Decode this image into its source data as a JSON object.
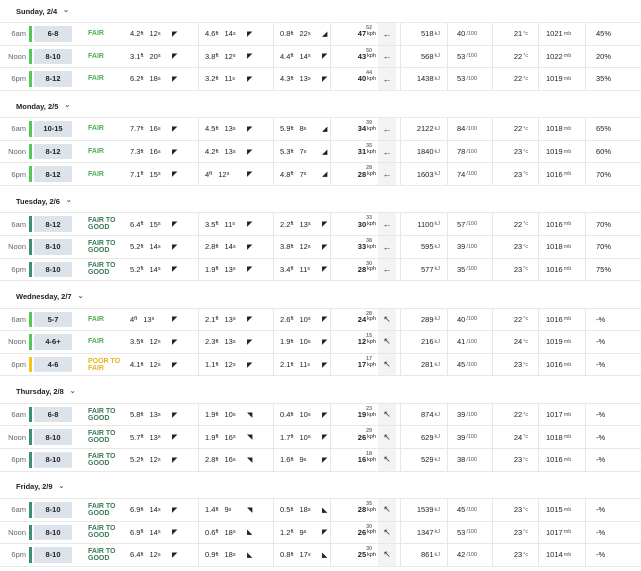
{
  "days": [
    {
      "title": "Sunday, 2/4",
      "rows": [
        {
          "time": "6am",
          "size": "6-8",
          "rating": "FAIR",
          "rc": "fair",
          "s1h": "4.2",
          "s1p": "12",
          "s1a": "◤",
          "s2h": "4.6",
          "s2p": "14",
          "s2a": "◤",
          "s3h": "0.8",
          "s3p": "22",
          "s3a": "◢",
          "wind": "47",
          "gust": "52",
          "warrow": "←",
          "energy": "518",
          "cons": "40",
          "temp": "21",
          "pres": "1021",
          "cloud": "45%"
        },
        {
          "time": "Noon",
          "size": "8-10",
          "rating": "FAIR",
          "rc": "fair",
          "s1h": "3.1",
          "s1p": "20",
          "s1a": "◤",
          "s2h": "3.8",
          "s2p": "12",
          "s2a": "◤",
          "s3h": "4.4",
          "s3p": "14",
          "s3a": "◤",
          "wind": "43",
          "gust": "50",
          "warrow": "←",
          "energy": "568",
          "cons": "53",
          "temp": "22",
          "pres": "1022",
          "cloud": "20%"
        },
        {
          "time": "6pm",
          "size": "8-12",
          "rating": "FAIR",
          "rc": "fair",
          "s1h": "6.2",
          "s1p": "18",
          "s1a": "◤",
          "s2h": "3.2",
          "s2p": "11",
          "s2a": "◤",
          "s3h": "4.3",
          "s3p": "13",
          "s3a": "◤",
          "wind": "40",
          "gust": "44",
          "warrow": "←",
          "energy": "1438",
          "cons": "53",
          "temp": "22",
          "pres": "1019",
          "cloud": "35%"
        }
      ]
    },
    {
      "title": "Monday, 2/5",
      "rows": [
        {
          "time": "6am",
          "size": "10-15",
          "rating": "FAIR",
          "rc": "fair",
          "s1h": "7.7",
          "s1p": "16",
          "s1a": "◤",
          "s2h": "4.5",
          "s2p": "13",
          "s2a": "◤",
          "s3h": "5.9",
          "s3p": "8",
          "s3a": "◢",
          "wind": "34",
          "gust": "39",
          "warrow": "←",
          "energy": "2122",
          "cons": "84",
          "temp": "22",
          "pres": "1018",
          "cloud": "65%"
        },
        {
          "time": "Noon",
          "size": "8-12",
          "rating": "FAIR",
          "rc": "fair",
          "s1h": "7.3",
          "s1p": "16",
          "s1a": "◤",
          "s2h": "4.2",
          "s2p": "13",
          "s2a": "◤",
          "s3h": "5.3",
          "s3p": "7",
          "s3a": "◢",
          "wind": "31",
          "gust": "35",
          "warrow": "←",
          "energy": "1840",
          "cons": "78",
          "temp": "23",
          "pres": "1019",
          "cloud": "60%"
        },
        {
          "time": "6pm",
          "size": "8-12",
          "rating": "FAIR",
          "rc": "fair",
          "s1h": "7.1",
          "s1p": "15",
          "s1a": "◤",
          "s2h": "4",
          "s2p": "12",
          "s2a": "◤",
          "s3h": "4.8",
          "s3p": "7",
          "s3a": "◢",
          "wind": "28",
          "gust": "28",
          "warrow": "←",
          "energy": "1603",
          "cons": "74",
          "temp": "23",
          "pres": "1016",
          "cloud": "70%"
        }
      ]
    },
    {
      "title": "Tuesday, 2/6",
      "rows": [
        {
          "time": "6am",
          "size": "8-12",
          "rating": "FAIR TO GOOD",
          "rc": "good",
          "s1h": "6.4",
          "s1p": "15",
          "s1a": "◤",
          "s2h": "3.5",
          "s2p": "11",
          "s2a": "◤",
          "s3h": "2.2",
          "s3p": "13",
          "s3a": "◤",
          "wind": "30",
          "gust": "33",
          "warrow": "←",
          "energy": "1100",
          "cons": "57",
          "temp": "22",
          "pres": "1016",
          "cloud": "70%"
        },
        {
          "time": "Noon",
          "size": "8-10",
          "rating": "FAIR TO GOOD",
          "rc": "good",
          "s1h": "5.2",
          "s1p": "14",
          "s1a": "◤",
          "s2h": "2.8",
          "s2p": "14",
          "s2a": "◤",
          "s3h": "3.8",
          "s3p": "12",
          "s3a": "◤",
          "wind": "33",
          "gust": "38",
          "warrow": "←",
          "energy": "595",
          "cons": "39",
          "temp": "23",
          "pres": "1018",
          "cloud": "70%"
        },
        {
          "time": "6pm",
          "size": "8-10",
          "rating": "FAIR TO GOOD",
          "rc": "good",
          "s1h": "5.2",
          "s1p": "14",
          "s1a": "◤",
          "s2h": "1.9",
          "s2p": "13",
          "s2a": "◤",
          "s3h": "3.4",
          "s3p": "11",
          "s3a": "◤",
          "wind": "28",
          "gust": "30",
          "warrow": "←",
          "energy": "577",
          "cons": "35",
          "temp": "23",
          "pres": "1016",
          "cloud": "75%"
        }
      ]
    },
    {
      "title": "Wednesday, 2/7",
      "rows": [
        {
          "time": "6am",
          "size": "5-7",
          "rating": "FAIR",
          "rc": "fair",
          "s1h": "4",
          "s1p": "13",
          "s1a": "◤",
          "s2h": "2.1",
          "s2p": "13",
          "s2a": "◤",
          "s3h": "2.6",
          "s3p": "10",
          "s3a": "◤",
          "wind": "24",
          "gust": "28",
          "warrow": "↖",
          "energy": "289",
          "cons": "40",
          "temp": "22",
          "pres": "1016",
          "cloud": "-%"
        },
        {
          "time": "Noon",
          "size": "4-6+",
          "rating": "FAIR",
          "rc": "fair",
          "s1h": "3.5",
          "s1p": "12",
          "s1a": "◤",
          "s2h": "2.3",
          "s2p": "13",
          "s2a": "◤",
          "s3h": "1.9",
          "s3p": "10",
          "s3a": "◤",
          "wind": "12",
          "gust": "15",
          "warrow": "↖",
          "energy": "216",
          "cons": "41",
          "temp": "24",
          "pres": "1019",
          "cloud": "-%"
        },
        {
          "time": "6pm",
          "size": "4-6",
          "rating": "POOR TO FAIR",
          "rc": "poor",
          "s1h": "4.1",
          "s1p": "12",
          "s1a": "◤",
          "s2h": "1.1",
          "s2p": "12",
          "s2a": "◤",
          "s3h": "2.1",
          "s3p": "11",
          "s3a": "◤",
          "wind": "17",
          "gust": "17",
          "warrow": "↖",
          "energy": "281",
          "cons": "45",
          "temp": "23",
          "pres": "1016",
          "cloud": "-%"
        }
      ]
    },
    {
      "title": "Thursday, 2/8",
      "rows": [
        {
          "time": "6am",
          "size": "6-8",
          "rating": "FAIR TO GOOD",
          "rc": "good",
          "s1h": "5.8",
          "s1p": "13",
          "s1a": "◤",
          "s2h": "1.9",
          "s2p": "10",
          "s2a": "◥",
          "s3h": "0.4",
          "s3p": "10",
          "s3a": "◤",
          "wind": "19",
          "gust": "23",
          "warrow": "↖",
          "energy": "874",
          "cons": "39",
          "temp": "22",
          "pres": "1017",
          "cloud": "-%"
        },
        {
          "time": "Noon",
          "size": "8-10",
          "rating": "FAIR TO GOOD",
          "rc": "good",
          "s1h": "5.7",
          "s1p": "13",
          "s1a": "◤",
          "s2h": "1.9",
          "s2p": "16",
          "s2a": "◥",
          "s3h": "1.7",
          "s3p": "10",
          "s3a": "◤",
          "wind": "26",
          "gust": "29",
          "warrow": "↖",
          "energy": "629",
          "cons": "39",
          "temp": "24",
          "pres": "1018",
          "cloud": "-%"
        },
        {
          "time": "6pm",
          "size": "8-10",
          "rating": "FAIR TO GOOD",
          "rc": "good",
          "s1h": "5.2",
          "s1p": "12",
          "s1a": "◤",
          "s2h": "2.8",
          "s2p": "16",
          "s2a": "◥",
          "s3h": "1.6",
          "s3p": "9",
          "s3a": "◤",
          "wind": "16",
          "gust": "18",
          "warrow": "↖",
          "energy": "529",
          "cons": "38",
          "temp": "23",
          "pres": "1016",
          "cloud": "-%"
        }
      ]
    },
    {
      "title": "Friday, 2/9",
      "rows": [
        {
          "time": "6am",
          "size": "8-10",
          "rating": "FAIR TO GOOD",
          "rc": "good",
          "s1h": "6.9",
          "s1p": "14",
          "s1a": "◤",
          "s2h": "1.4",
          "s2p": "9",
          "s2a": "◥",
          "s3h": "0.5",
          "s3p": "18",
          "s3a": "◣",
          "wind": "28",
          "gust": "35",
          "warrow": "↖",
          "energy": "1539",
          "cons": "45",
          "temp": "23",
          "pres": "1015",
          "cloud": "-%"
        },
        {
          "time": "Noon",
          "size": "8-10",
          "rating": "FAIR TO GOOD",
          "rc": "good",
          "s1h": "6.9",
          "s1p": "14",
          "s1a": "◤",
          "s2h": "0.6",
          "s2p": "18",
          "s2a": "◣",
          "s3h": "1.2",
          "s3p": "9",
          "s3a": "◤",
          "wind": "26",
          "gust": "30",
          "warrow": "↖",
          "energy": "1347",
          "cons": "53",
          "temp": "23",
          "pres": "1017",
          "cloud": "-%"
        },
        {
          "time": "6pm",
          "size": "8-10",
          "rating": "FAIR TO GOOD",
          "rc": "good",
          "s1h": "6.4",
          "s1p": "12",
          "s1a": "◤",
          "s2h": "0.9",
          "s2p": "18",
          "s2a": "◣",
          "s3h": "0.8",
          "s3p": "17",
          "s3a": "◣",
          "wind": "25",
          "gust": "30",
          "warrow": "↖",
          "energy": "861",
          "cons": "42",
          "temp": "23",
          "pres": "1014",
          "cloud": "-%"
        }
      ]
    }
  ],
  "units": {
    "ft": "ft",
    "s": "s",
    "kph": "kph",
    "kj": "kJ",
    "cons": "/100",
    "temp": "°c",
    "mb": "mb"
  }
}
